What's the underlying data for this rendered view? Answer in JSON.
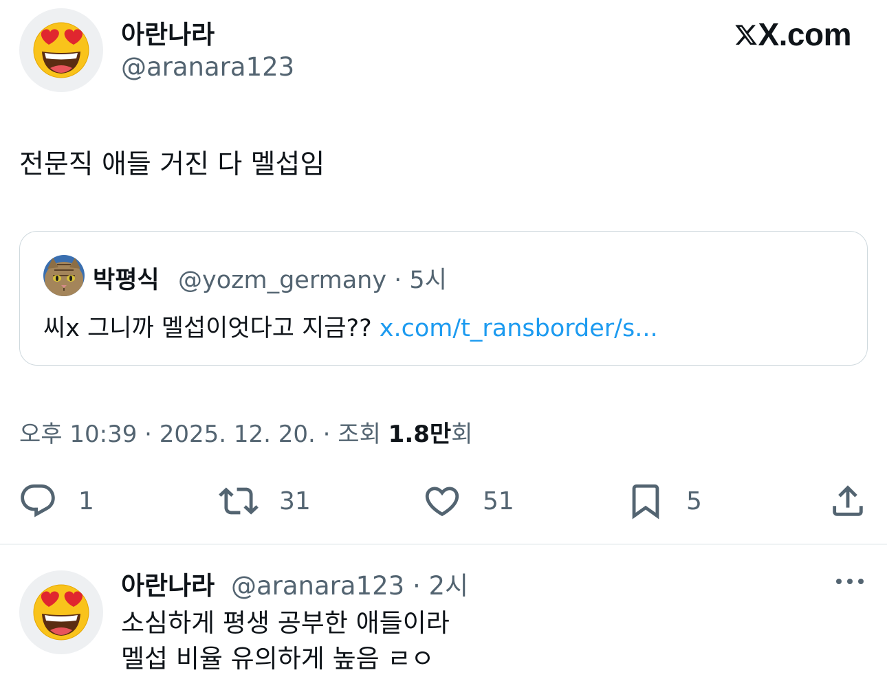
{
  "tweet": {
    "author_name": "아란나라",
    "author_handle": "@aranara123",
    "text": "전문직 애들 거진 다 멜섭임",
    "brand": "X.com"
  },
  "quote": {
    "author_name": "박평식",
    "author_handle": "@yozm_germany · 5시",
    "text": "씨x 그니까 멜섭이엇다고 지금?? ",
    "link": "x.com/t_ransborder/s..."
  },
  "meta": {
    "time_date": "오후 10:39 · 2025. 12. 20. · 조회 ",
    "views_count": "1.8만",
    "views_suffix": "회"
  },
  "actions": {
    "reply_count": "1",
    "retweet_count": "31",
    "like_count": "51",
    "bookmark_count": "5"
  },
  "reply": {
    "author_name": "아란나라",
    "author_handle": "@aranara123 · 2시",
    "line1": "소심하게 평생 공부한 애들이라",
    "line2": "멜섭 비율 유의하게 높음 ㄹㅇ"
  },
  "colors": {
    "text_primary": "#0f1419",
    "text_secondary": "#536471",
    "link": "#1d9bf0",
    "border": "#cfd9de"
  },
  "icons": [
    "heart-eyes-emoji",
    "x-logo-icon",
    "cat-avatar",
    "reply-icon",
    "retweet-icon",
    "like-icon",
    "bookmark-icon",
    "share-icon",
    "more-icon"
  ]
}
